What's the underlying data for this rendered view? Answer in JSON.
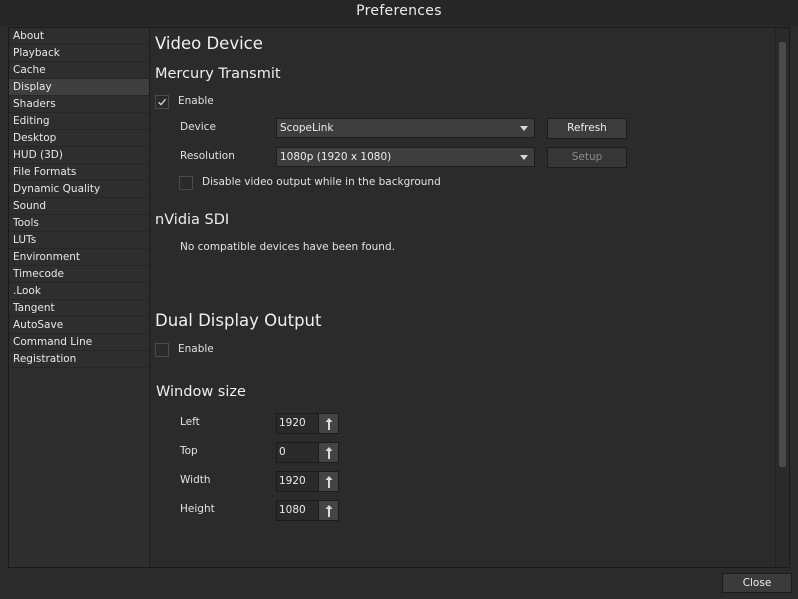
{
  "window": {
    "title": "Preferences"
  },
  "sidebar": {
    "items": [
      {
        "label": "About"
      },
      {
        "label": "Playback"
      },
      {
        "label": "Cache"
      },
      {
        "label": "Display"
      },
      {
        "label": "Shaders"
      },
      {
        "label": "Editing"
      },
      {
        "label": "Desktop"
      },
      {
        "label": "HUD (3D)"
      },
      {
        "label": "File Formats"
      },
      {
        "label": "Dynamic Quality"
      },
      {
        "label": "Sound"
      },
      {
        "label": "Tools"
      },
      {
        "label": "LUTs"
      },
      {
        "label": "Environment"
      },
      {
        "label": "Timecode"
      },
      {
        "label": ".Look"
      },
      {
        "label": "Tangent"
      },
      {
        "label": "AutoSave"
      },
      {
        "label": "Command Line"
      },
      {
        "label": "Registration"
      }
    ],
    "selected_index": 3
  },
  "video_device": {
    "title": "Video Device",
    "mercury": {
      "title": "Mercury Transmit",
      "enable_label": "Enable",
      "enable_checked": true,
      "device_label": "Device",
      "device_value": "ScopeLink",
      "refresh_label": "Refresh",
      "resolution_label": "Resolution",
      "resolution_value": "1080p (1920 x 1080)",
      "setup_label": "Setup",
      "disable_bg_label": "Disable video output while in the background",
      "disable_bg_checked": false
    },
    "nvidia": {
      "title": "nVidia SDI",
      "message": "No compatible devices have been found."
    }
  },
  "dual_display": {
    "title": "Dual Display Output",
    "enable_label": "Enable",
    "enable_checked": false
  },
  "window_size": {
    "title": "Window size",
    "left_label": "Left",
    "left_value": "1920",
    "top_label": "Top",
    "top_value": "0",
    "width_label": "Width",
    "width_value": "1920",
    "height_label": "Height",
    "height_value": "1080"
  },
  "footer": {
    "close_label": "Close"
  },
  "colors": {
    "background": "#2b2b2b",
    "selected": "#3f3f3f",
    "text": "#e6e6e6"
  }
}
